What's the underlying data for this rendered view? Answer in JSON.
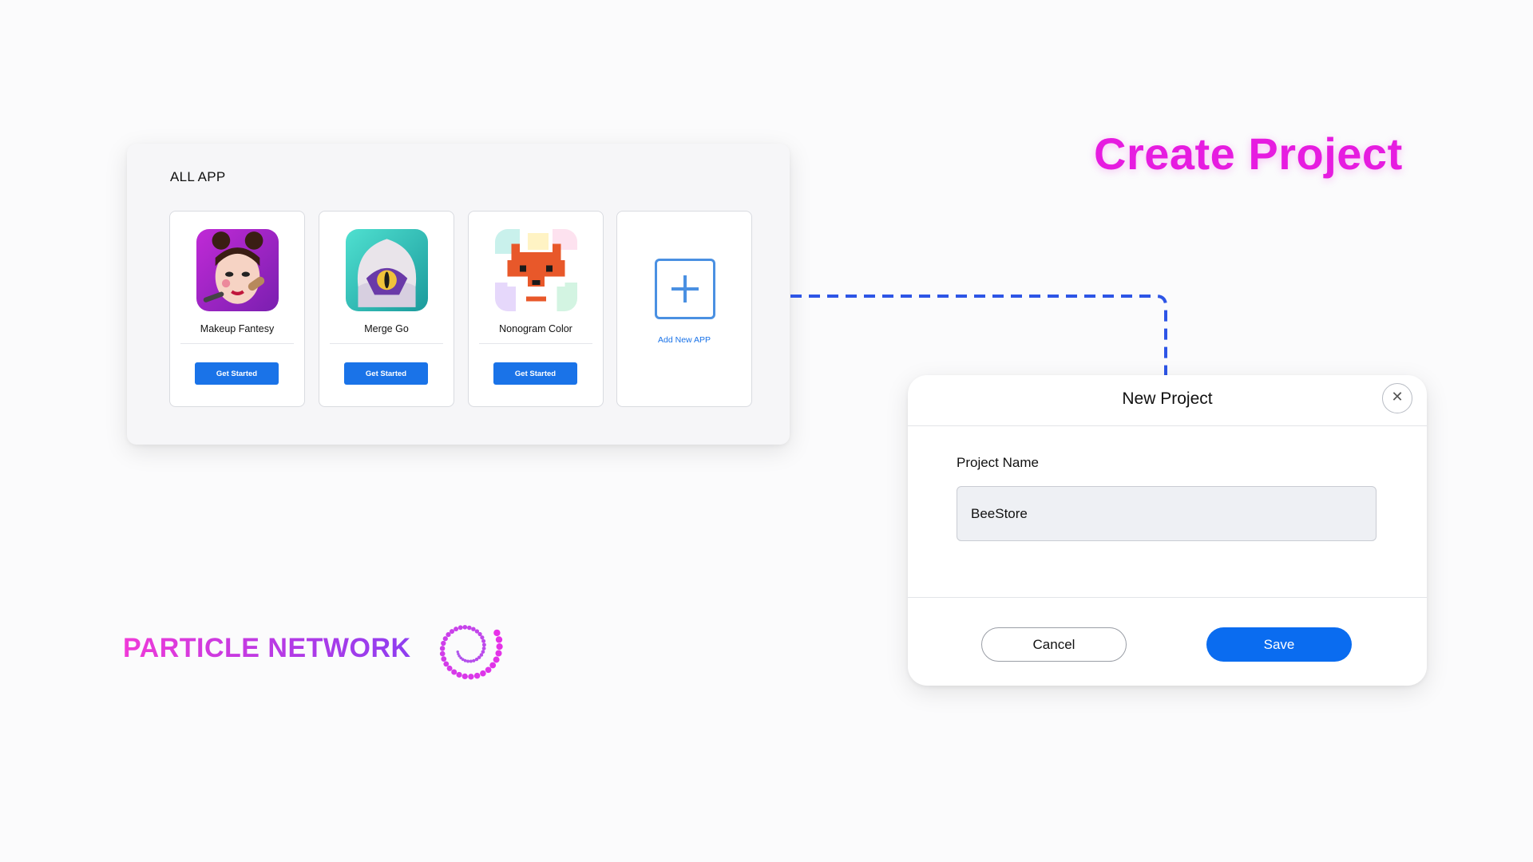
{
  "hero": {
    "title": "Create Project"
  },
  "app_panel": {
    "title": "ALL APP",
    "apps": [
      {
        "name": "Makeup Fantesy",
        "button": "Get Started"
      },
      {
        "name": "Merge Go",
        "button": "Get Started"
      },
      {
        "name": "Nonogram Color",
        "button": "Get Started"
      }
    ],
    "add_new_label": "Add New APP"
  },
  "dialog": {
    "title": "New Project",
    "close_icon": "close-icon",
    "field_label": "Project Name",
    "field_value": "BeeStore",
    "cancel_label": "Cancel",
    "save_label": "Save"
  },
  "brand": {
    "name": "PARTICLE NETWORK",
    "logo": "spiral-dots-logo"
  },
  "colors": {
    "accent_blue": "#1a73e8",
    "save_blue": "#0a6cf0",
    "title_magenta": "#e61ce0",
    "connector_blue": "#2d55e6"
  }
}
